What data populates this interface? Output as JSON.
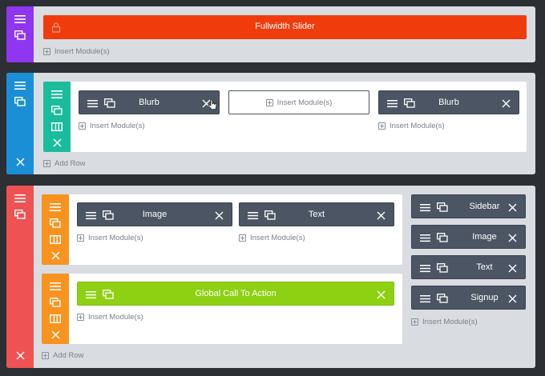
{
  "colors": {
    "section1": "#8e36f2",
    "section2": "#1b8fd6",
    "section3": "#ee5252",
    "row_teal": "#1bbc9c",
    "row_orange": "#f7931e",
    "fullwidth_module": "#f03c0c",
    "global_module": "#8ed113",
    "module": "#4b5563"
  },
  "icons": [
    "hamburger-icon",
    "duplicate-icon",
    "columns-icon",
    "close-icon",
    "plus-icon",
    "lock-icon",
    "cursor-hand-icon"
  ],
  "section1": {
    "fullwidth_module": "Fullwidth Slider",
    "insert": "Insert Module(s)"
  },
  "section2": {
    "row": {
      "col1": {
        "module": "Blurb",
        "insert": "Insert Module(s)"
      },
      "col2": {
        "insert_box": "Insert Module(s)"
      },
      "col3": {
        "module": "Blurb",
        "insert": "Insert Module(s)"
      }
    },
    "add_row": "Add Row"
  },
  "section3": {
    "row1": {
      "col1": {
        "module": "Image",
        "insert": "Insert Module(s)"
      },
      "col2": {
        "module": "Text",
        "insert": "Insert Module(s)"
      }
    },
    "row2": {
      "module": "Global Call To Action",
      "insert": "Insert Module(s)"
    },
    "sidebar": {
      "modules": [
        "Sidebar",
        "Image",
        "Text",
        "Signup"
      ],
      "insert": "Insert Module(s)"
    },
    "add_row": "Add Row"
  }
}
